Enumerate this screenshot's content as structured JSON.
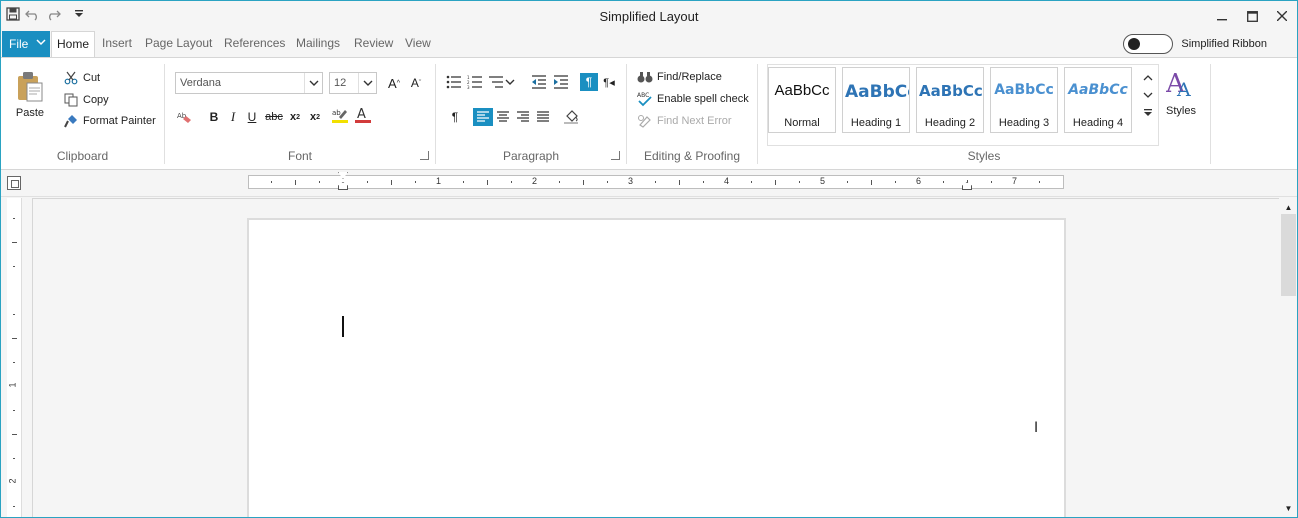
{
  "window": {
    "title": "Simplified Layout",
    "qat": {
      "save_icon": "save-icon",
      "undo_icon": "undo-icon",
      "redo_icon": "redo-icon",
      "customize_icon": "qat-dropdown-icon"
    }
  },
  "tabs": {
    "file": "File",
    "items": [
      "Home",
      "Insert",
      "Page Layout",
      "References",
      "Mailings",
      "Review",
      "View"
    ],
    "active": "Home",
    "simplified_ribbon": "Simplified Ribbon"
  },
  "ribbon": {
    "clipboard": {
      "label": "Clipboard",
      "paste": "Paste",
      "cut": "Cut",
      "copy": "Copy",
      "format_painter": "Format Painter"
    },
    "font": {
      "label": "Font",
      "font_name": "Verdana",
      "font_size": "12"
    },
    "paragraph": {
      "label": "Paragraph"
    },
    "editing": {
      "label": "Editing & Proofing",
      "find_replace": "Find/Replace",
      "spell_check": "Enable spell check",
      "find_next_error": "Find Next Error"
    },
    "styles": {
      "label": "Styles",
      "button": "Styles",
      "tiles": [
        {
          "sample": "AaBbCc",
          "name": "Normal"
        },
        {
          "sample": "AaBbCc",
          "name": "Heading 1"
        },
        {
          "sample": "AaBbCc",
          "name": "Heading 2"
        },
        {
          "sample": "AaBbCc",
          "name": "Heading 3"
        },
        {
          "sample": "AaBbCc",
          "name": "Heading 4"
        }
      ]
    }
  },
  "ruler": {
    "numbers": [
      "1",
      "2",
      "3",
      "4",
      "5",
      "6",
      "7"
    ],
    "vnumbers": [
      "1",
      "2"
    ]
  },
  "colors": {
    "accent": "#1a8fc1",
    "heading": "#2e74b5"
  }
}
